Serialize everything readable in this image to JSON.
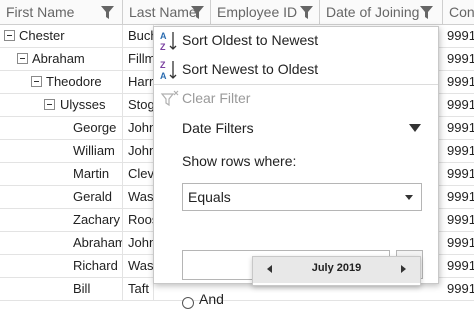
{
  "grid": {
    "columns": [
      {
        "label": "First Name"
      },
      {
        "label": "Last Name"
      },
      {
        "label": "Employee ID"
      },
      {
        "label": "Date of Joining"
      },
      {
        "label": "Cont"
      }
    ],
    "rows": [
      {
        "first": "Chester",
        "last": "Bucha",
        "contact": "9991"
      },
      {
        "first": "Abraham",
        "last": "Fillmo",
        "contact": "9991"
      },
      {
        "first": "Theodore",
        "last": "Harris",
        "contact": "9991"
      },
      {
        "first": "Ulysses",
        "last": "Stogn",
        "contact": "9991"
      },
      {
        "first": "George",
        "last": "Johns",
        "contact": "9991"
      },
      {
        "first": "William",
        "last": "Johns",
        "contact": "9991"
      },
      {
        "first": "Martin",
        "last": "Cleve",
        "contact": "9991"
      },
      {
        "first": "Gerald",
        "last": "Wash",
        "contact": "9991"
      },
      {
        "first": "Zachary",
        "last": "Roose",
        "contact": "9991"
      },
      {
        "first": "Abraham",
        "last": "Johns",
        "contact": "9991"
      },
      {
        "first": "Richard",
        "last": "Wash",
        "contact": "9991"
      },
      {
        "first": "Bill",
        "last": "Taft",
        "contact": "9991"
      }
    ]
  },
  "filter_popup": {
    "sort_oldest": "Sort Oldest to Newest",
    "sort_newest": "Sort Newest to Oldest",
    "clear_filter": "Clear Filter",
    "date_filters": "Date Filters",
    "show_rows_where": "Show rows where:",
    "operator": "Equals",
    "date_value": "",
    "and_label": "And",
    "calendar_month": "July 2019",
    "sort_icon_a": "A",
    "sort_icon_z": "Z"
  },
  "colors": {
    "header_bg": "#fafafa",
    "grid_line": "#e3e3e3",
    "sort_icon_purple": "#7a3fa0",
    "sort_icon_blue": "#2b6cb0"
  }
}
